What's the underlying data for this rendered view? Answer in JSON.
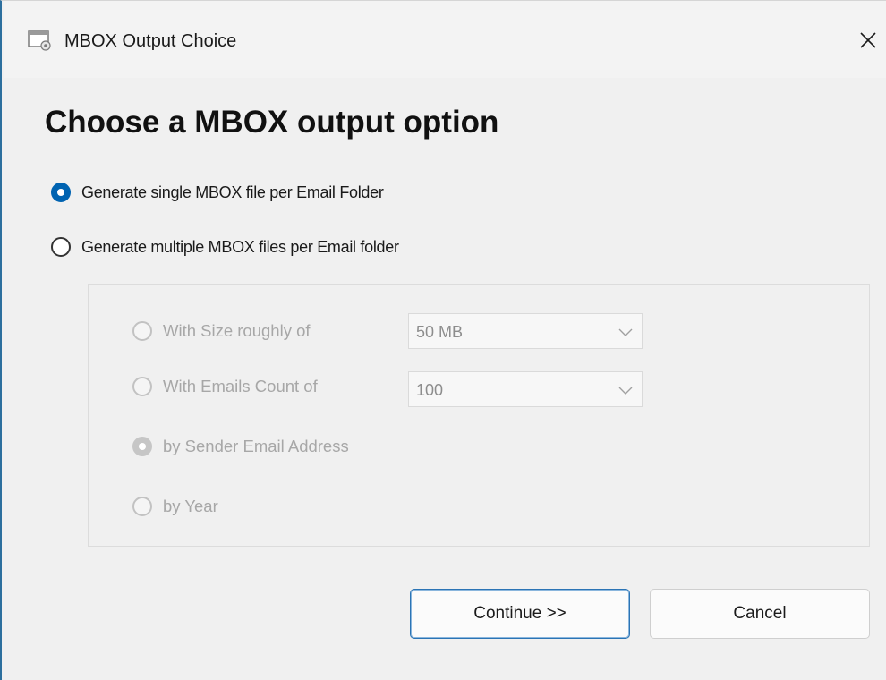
{
  "window": {
    "title": "MBOX Output Choice",
    "close_glyph": "✕"
  },
  "heading": "Choose a MBOX output option",
  "options": {
    "single": {
      "label": "Generate single MBOX file per Email Folder",
      "checked": true
    },
    "multiple": {
      "label": "Generate multiple MBOX files per Email folder",
      "checked": false
    }
  },
  "sub_options": {
    "size": {
      "label": "With Size roughly of",
      "checked": false,
      "value": "50 MB"
    },
    "count": {
      "label": "With Emails Count of",
      "checked": false,
      "value": "100"
    },
    "sender": {
      "label": "by Sender Email Address",
      "checked": true
    },
    "year": {
      "label": "by Year",
      "checked": false
    }
  },
  "buttons": {
    "continue": "Continue >>",
    "cancel": "Cancel"
  },
  "icons": {
    "app": "window-app-icon",
    "close": "close-icon",
    "dropdown": "chevron-down-icon"
  },
  "colors": {
    "accent": "#0063b1",
    "disabled_text": "#a7a7a7",
    "window_bg": "#f0f0f0"
  }
}
